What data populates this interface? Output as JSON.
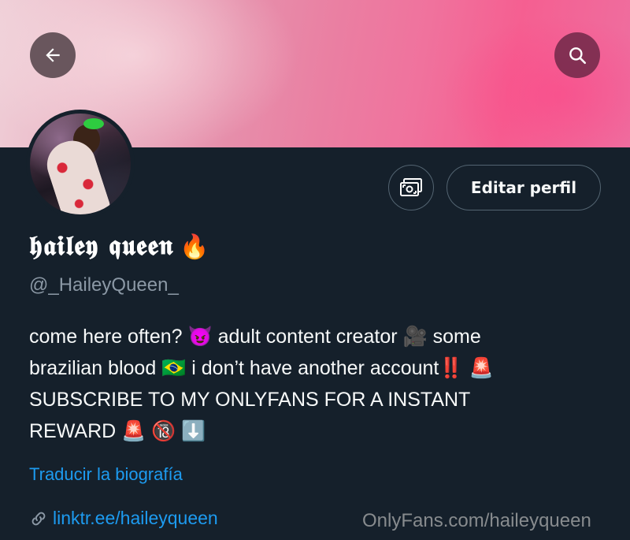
{
  "header": {
    "back_icon": "arrow-left-icon",
    "search_icon": "search-icon",
    "banner_colors": [
      "#efd0d8",
      "#e68fab",
      "#f55f91"
    ]
  },
  "profile": {
    "avatar": "profile-photo",
    "media_icon": "money-icon",
    "edit_label": "Editar perfil",
    "display_name": "𝖍𝖆𝖎𝖑𝖊𝖞 𝖖𝖚𝖊𝖊𝖓",
    "name_emoji": "🔥",
    "handle": "@_HaileyQueen_",
    "bio": {
      "line1_a": "come here often?",
      "emoji_devil": "😈",
      "line1_b": "adult content creator",
      "emoji_camera": "🎥",
      "line1_c": "some",
      "line2_a": "brazilian blood",
      "emoji_flag": "🇧🇷",
      "line2_b": "i don’t have another account",
      "emoji_bangbang": "‼️",
      "emoji_siren": "🚨",
      "line3": "SUBSCRIBE TO MY ONLYFANS FOR A INSTANT",
      "line4": "REWARD",
      "emoji_siren2": "🚨",
      "emoji_18": "🔞",
      "emoji_down": "⬇️"
    },
    "translate_label": "Traducir la biografía",
    "link_icon": "link-icon",
    "link_text": "linktr.ee/haileyqueen"
  },
  "watermark": "OnlyFans.com/haileyqueen",
  "colors": {
    "background": "#15202b",
    "accent": "#1d9bf0",
    "secondary_text": "#8b98a5"
  }
}
